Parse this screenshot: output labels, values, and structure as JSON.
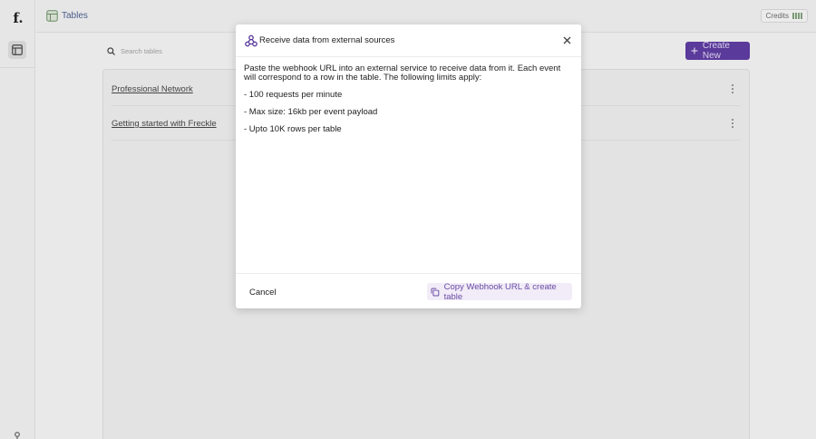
{
  "app": {
    "logo_text": "f."
  },
  "header": {
    "title": "Tables",
    "credits_label": "Credits"
  },
  "toolbar": {
    "search_placeholder": "Search tables",
    "create_label": "Create New"
  },
  "tables": [
    {
      "name": "Professional Network"
    },
    {
      "name": "Getting started with Freckle"
    }
  ],
  "modal": {
    "title": "Receive data from external sources",
    "intro": "Paste the webhook URL into an external service to receive data from it. Each event will correspond to a row in the table. The following limits apply:",
    "limits": [
      "- 100 requests per minute",
      "- Max size: 16kb per event payload",
      "- Upto 10K rows per table"
    ],
    "cancel_label": "Cancel",
    "copy_label": "Copy Webhook URL & create table"
  },
  "colors": {
    "accent": "#5a3a9a",
    "accent_soft": "#f1ecf7",
    "credit_bar": "#7c9a78"
  },
  "icons": [
    "table-icon",
    "search-icon",
    "plus-icon",
    "more-vertical-icon",
    "webhook-icon",
    "close-icon",
    "copy-icon"
  ]
}
